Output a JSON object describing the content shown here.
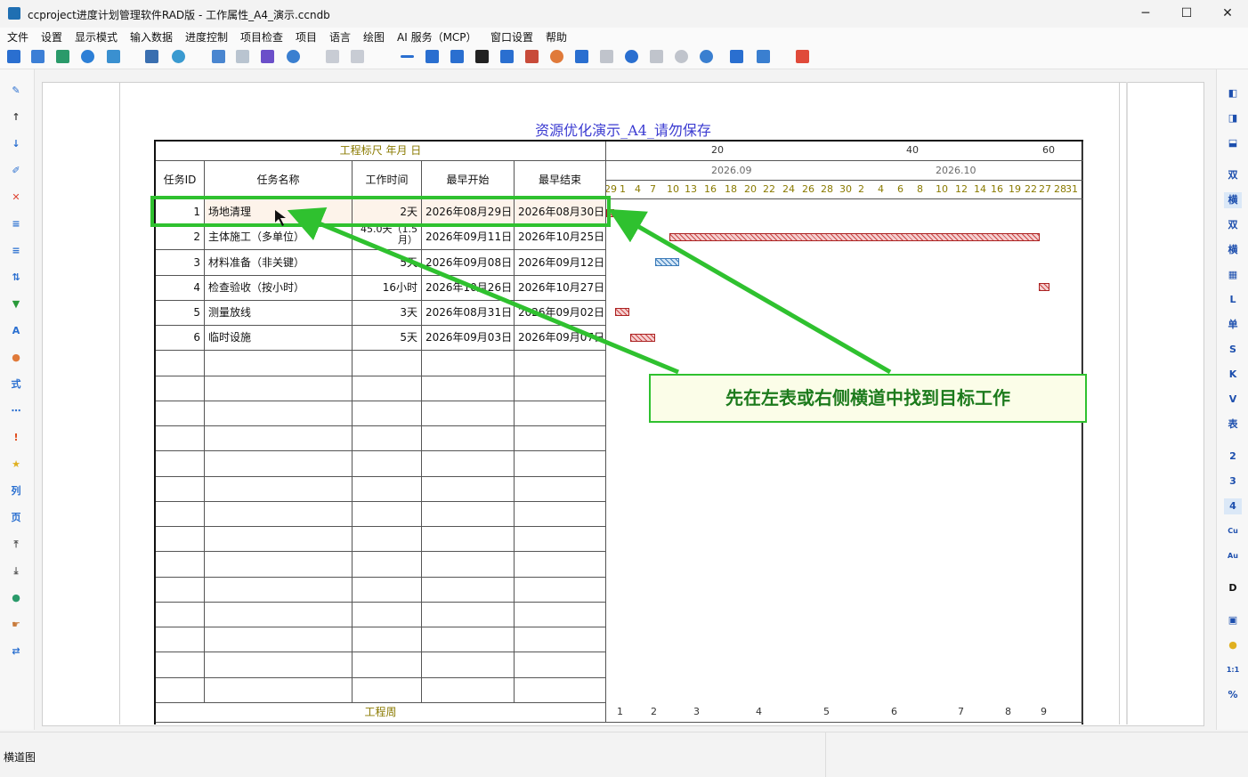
{
  "window": {
    "title": "ccproject进度计划管理软件RAD版 - 工作属性_A4_演示.ccndb",
    "minimize": "─",
    "maximize": "☐",
    "close": "✕"
  },
  "menu": [
    "文件",
    "设置",
    "显示模式",
    "输入数据",
    "进度控制",
    "项目检查",
    "项目",
    "语言",
    "绘图",
    "AI 服务（MCP）",
    "窗口设置",
    "帮助"
  ],
  "right_toolbar": [
    "双",
    "横",
    "双",
    "横",
    "L",
    "单",
    "S",
    "K",
    "V",
    "表",
    "2",
    "3",
    "4",
    "Cu",
    "Au",
    "D",
    "1:1",
    "%"
  ],
  "left_toolbar_text": [
    "式",
    "列",
    "页"
  ],
  "document": {
    "title": "资源优化演示_A4_请勿保存",
    "ruler_label": "工程标尺  年月 日",
    "headers": {
      "id": "任务ID",
      "name": "任务名称",
      "duration": "工作时间",
      "es": "最早开始",
      "ef": "最早结束"
    },
    "day_scale": [
      "20",
      "40",
      "60"
    ],
    "months": [
      "2026.09",
      "2026.10"
    ],
    "days": [
      "29",
      "1",
      "4",
      "7",
      "10",
      "13",
      "16",
      "18",
      "20",
      "22",
      "24",
      "26",
      "28",
      "30",
      "2",
      "4",
      "6",
      "8",
      "10",
      "12",
      "14",
      "16",
      "19",
      "22",
      "27",
      "28",
      "31"
    ],
    "tasks": [
      {
        "id": "1",
        "name": "场地清理",
        "duration": "2天",
        "es": "2026年08月29日",
        "ef": "2026年08月30日"
      },
      {
        "id": "2",
        "name": "主体施工（多单位）",
        "duration": "45.0天（1.5月）",
        "es": "2026年09月11日",
        "ef": "2026年10月25日"
      },
      {
        "id": "3",
        "name": "材料准备（非关键）",
        "duration": "5天",
        "es": "2026年09月08日",
        "ef": "2026年09月12日"
      },
      {
        "id": "4",
        "name": "检查验收（按小时）",
        "duration": "16小时",
        "es": "2026年10月26日",
        "ef": "2026年10月27日"
      },
      {
        "id": "5",
        "name": "测量放线",
        "duration": "3天",
        "es": "2026年08月31日",
        "ef": "2026年09月02日"
      },
      {
        "id": "6",
        "name": "临时设施",
        "duration": "5天",
        "es": "2026年09月03日",
        "ef": "2026年09月07日"
      }
    ],
    "footer_label": "工程周",
    "weeks": [
      "1",
      "2",
      "3",
      "4",
      "5",
      "6",
      "7",
      "8",
      "9"
    ]
  },
  "callout": "先在左表或右侧横道中找到目标工作",
  "status": "横道图",
  "colors": {
    "accent_green": "#2fc12f",
    "title_blue": "#3b3bd1",
    "bar_red": "#c44",
    "bar_blue": "#3a7ab8"
  }
}
